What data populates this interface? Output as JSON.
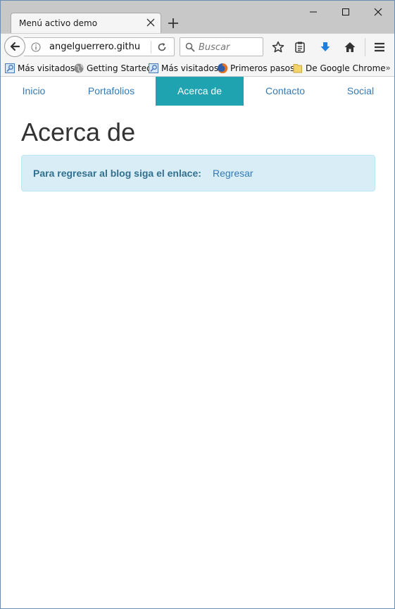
{
  "browser": {
    "tab_title": "Menú activo demo",
    "url": "angelguerrero.githu",
    "search_placeholder": "Buscar"
  },
  "bookmarks": [
    {
      "label": "Más visitados",
      "icon": "bookmark-folder-icon"
    },
    {
      "label": "Getting Started",
      "icon": "globe-icon"
    },
    {
      "label": "Más visitados",
      "icon": "bookmark-folder-icon"
    },
    {
      "label": "Primeros pasos",
      "icon": "firefox-icon"
    },
    {
      "label": "De Google Chrome",
      "icon": "folder-icon"
    }
  ],
  "nav": {
    "items": [
      "Inicio",
      "Portafolios",
      "Acerca de",
      "Contacto",
      "Social"
    ],
    "active": "Acerca de"
  },
  "main": {
    "heading": "Acerca de",
    "alert_text": "Para regresar al blog siga el enlace:",
    "alert_link": "Regresar"
  },
  "colors": {
    "nav_active_bg": "#1fa3b1",
    "link": "#337ab7",
    "alert_bg": "#d9edf7",
    "alert_text": "#31708f"
  }
}
